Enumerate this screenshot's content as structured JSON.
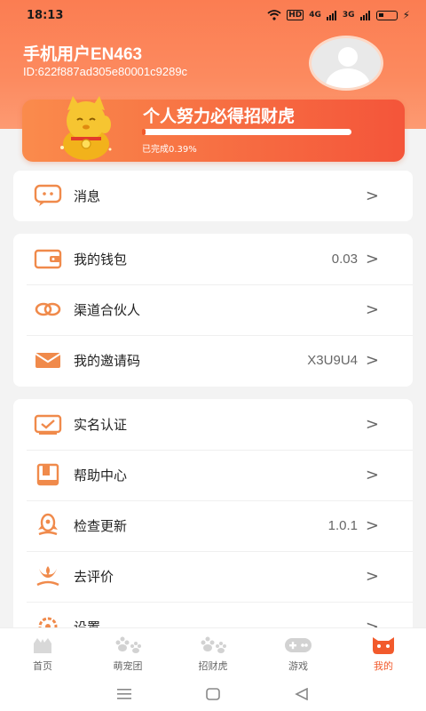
{
  "status": {
    "time": "18:13",
    "hd": "HD",
    "net1": "4G",
    "net2": "3G"
  },
  "user": {
    "name": "手机用户EN463",
    "id": "ID:622f887ad305e80001c9289c"
  },
  "banner": {
    "title": "个人努力必得招财虎",
    "progress_text": "已完成0.39%",
    "progress_percent": 0.39
  },
  "groups": [
    {
      "rows": [
        {
          "label": "消息",
          "value": "",
          "icon": "message-icon"
        }
      ]
    },
    {
      "rows": [
        {
          "label": "我的钱包",
          "value": "0.03",
          "icon": "wallet-icon"
        },
        {
          "label": "渠道合伙人",
          "value": "",
          "icon": "link-icon"
        },
        {
          "label": "我的邀请码",
          "value": "X3U9U4",
          "icon": "envelope-icon"
        }
      ]
    },
    {
      "rows": [
        {
          "label": "实名认证",
          "value": "",
          "icon": "id-card-icon"
        },
        {
          "label": "帮助中心",
          "value": "",
          "icon": "book-icon"
        },
        {
          "label": "检查更新",
          "value": "1.0.1",
          "icon": "rocket-icon"
        },
        {
          "label": "去评价",
          "value": "",
          "icon": "flower-icon"
        },
        {
          "label": "设置",
          "value": "",
          "icon": "gear-icon"
        }
      ]
    }
  ],
  "chevron": ">",
  "tabs": [
    {
      "label": "首页",
      "icon": "home-icon"
    },
    {
      "label": "萌宠团",
      "icon": "paw-icon"
    },
    {
      "label": "招财虎",
      "icon": "paw-icon"
    },
    {
      "label": "游戏",
      "icon": "gamepad-icon"
    },
    {
      "label": "我的",
      "icon": "tiger-face-icon",
      "active": true
    }
  ],
  "colors": {
    "accent": "#f25a2c",
    "header": "#fb7d52",
    "icon": "#f08a4b"
  }
}
